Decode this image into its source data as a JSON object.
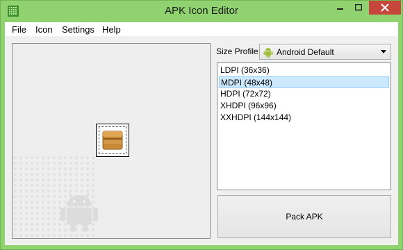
{
  "window": {
    "title": "APK Icon Editor",
    "controls": [
      "minimize-icon",
      "maximize-icon",
      "close-icon"
    ]
  },
  "menu": {
    "items": [
      {
        "label": "File"
      },
      {
        "label": "Icon"
      },
      {
        "label": "Settings"
      },
      {
        "label": "Help"
      }
    ]
  },
  "preview": {
    "icon": "box-icon"
  },
  "size_profile": {
    "label": "Size Profile:",
    "selected": "Android Default",
    "icon": "android-icon"
  },
  "size_list": {
    "items": [
      {
        "label": "LDPI (36x36)"
      },
      {
        "label": "MDPI (48x48)",
        "selected": true
      },
      {
        "label": "HDPI (72x72)"
      },
      {
        "label": "XHDPI (96x96)"
      },
      {
        "label": "XXHDPI (144x144)"
      }
    ]
  },
  "actions": {
    "pack_label": "Pack APK"
  },
  "colors": {
    "frame": "#8fd26f",
    "close": "#c7463c",
    "selection": "#cce8ff",
    "android": "#9fbf3b"
  }
}
